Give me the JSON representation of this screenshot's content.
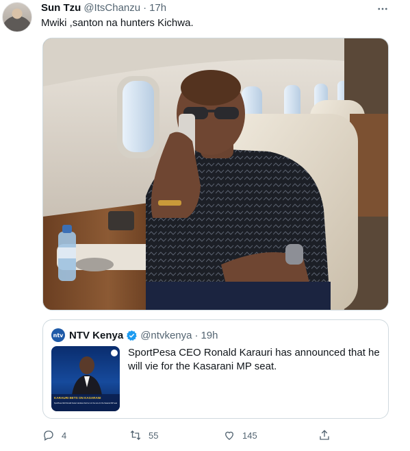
{
  "tweet": {
    "author": {
      "display_name": "Sun Tzu",
      "handle": "@ItsChanzu",
      "separator": "·",
      "time": "17h"
    },
    "text": "Mwiki ,santon na hunters Kichwa.",
    "more_icon": "more-horizontal-icon"
  },
  "quote": {
    "avatar_text": "ntv",
    "display_name": "NTV Kenya",
    "handle": "@ntvkenya",
    "separator": "·",
    "time": "19h",
    "verified_icon": "verified-badge-icon",
    "text": "SportPesa CEO Ronald Karauri has announced that he will vie for the Kasarani MP seat.",
    "thumb": {
      "headline": "KARAURI BETS ON KASARANI",
      "caption": "SportPesa CEO Ronald Karauri declares that he is in the race for the Kasarani MP seat"
    }
  },
  "actions": {
    "reply": {
      "icon": "reply-icon",
      "count": "4"
    },
    "retweet": {
      "icon": "retweet-icon",
      "count": "55"
    },
    "like": {
      "icon": "heart-icon",
      "count": "145"
    },
    "share": {
      "icon": "share-icon"
    }
  },
  "colors": {
    "text": "#0f1419",
    "muted": "#536471",
    "border": "#cfd9de",
    "verified": "#1d9bf0"
  }
}
